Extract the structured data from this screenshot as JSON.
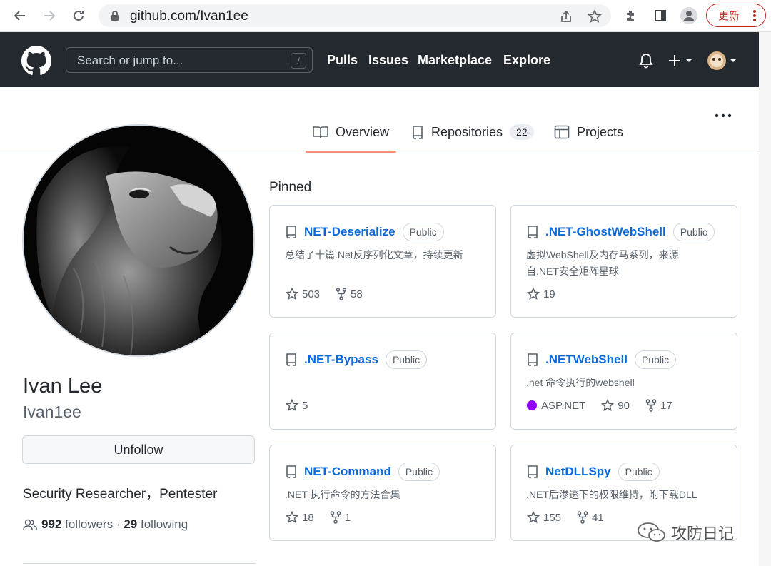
{
  "browser": {
    "url": "github.com/Ivan1ee",
    "update_label": "更新"
  },
  "header": {
    "search_placeholder": "Search or jump to...",
    "search_shortcut": "/",
    "nav": [
      "Pulls",
      "Issues",
      "Marketplace",
      "Explore"
    ]
  },
  "tabs": [
    {
      "label": "Overview",
      "selected": true
    },
    {
      "label": "Repositories",
      "count": "22"
    },
    {
      "label": "Projects"
    }
  ],
  "profile": {
    "name": "Ivan Lee",
    "login": "Ivan1ee",
    "follow_button": "Unfollow",
    "bio": "Security Researcher，Pentester",
    "followers_count": "992",
    "followers_label": "followers",
    "separator": "·",
    "following_count": "29",
    "following_label": "following"
  },
  "pinned": {
    "title": "Pinned",
    "repos": [
      {
        "name": "NET-Deserialize",
        "visibility": "Public",
        "description": "总结了十篇.Net反序列化文章，持续更新",
        "stars": "503",
        "forks": "58"
      },
      {
        "name": ".NET-GhostWebShell",
        "visibility": "Public",
        "description": "虚拟WebShell及内存马系列，来源自.NET安全矩阵星球",
        "stars": "19"
      },
      {
        "name": ".NET-Bypass",
        "visibility": "Public",
        "description": "",
        "stars": "5"
      },
      {
        "name": ".NETWebShell",
        "visibility": "Public",
        "description": ".net 命令执行的webshell",
        "language": "ASP.NET",
        "language_color": "#9400ff",
        "stars": "90",
        "forks": "17"
      },
      {
        "name": "NET-Command",
        "visibility": "Public",
        "description": ".NET 执行命令的方法合集",
        "stars": "18",
        "forks": "1"
      },
      {
        "name": "NetDLLSpy",
        "visibility": "Public",
        "description": ".NET后渗透下的权限维持，附下载DLL",
        "stars": "155",
        "forks": "41"
      }
    ]
  },
  "watermark": "攻防日记",
  "colors": {
    "header_bg": "#24292f",
    "link": "#0969da",
    "tab_underline": "#fd8c73",
    "update_red": "#c5221f"
  }
}
